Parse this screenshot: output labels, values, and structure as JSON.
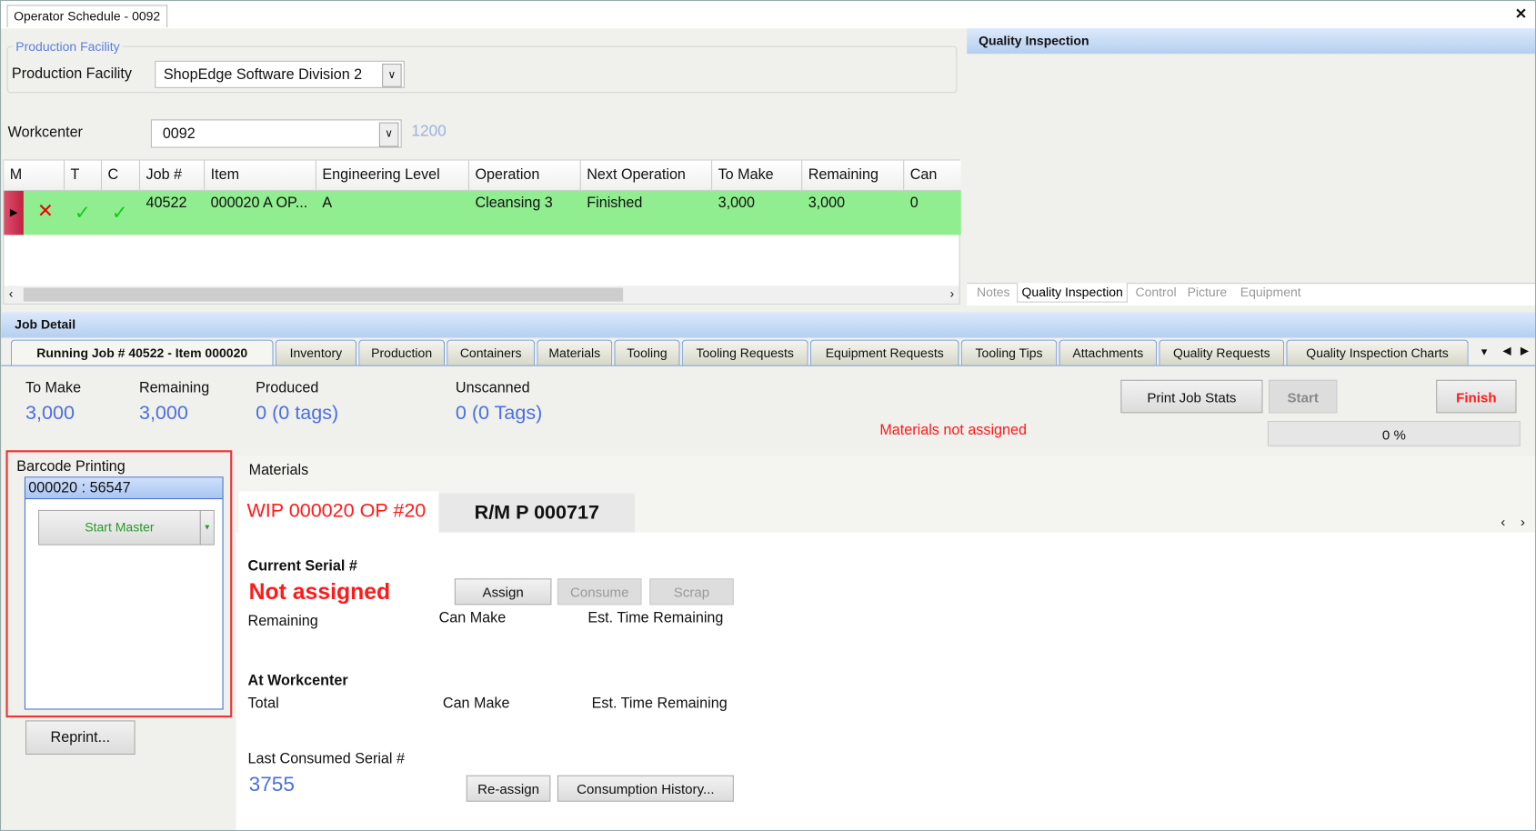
{
  "window": {
    "tab_title": "Operator Schedule - 0092",
    "close": "✕"
  },
  "facility": {
    "group_label": "Production Facility",
    "label": "Production Facility",
    "value": "ShopEdge Software Division 2"
  },
  "workcenter": {
    "label": "Workcenter",
    "value": "0092",
    "extra": "1200"
  },
  "grid": {
    "columns": [
      "M",
      "T",
      "C",
      "Job #",
      "Item",
      "Engineering Level",
      "Operation",
      "Next Operation",
      "To Make",
      "Remaining",
      "Can Ma"
    ],
    "row": {
      "m": "✕",
      "t": "✓",
      "c": "✓",
      "job": "40522",
      "item": "000020  A  OP...",
      "eng": "A",
      "operation": "Cleansing 3",
      "next": "Finished",
      "to_make": "3,000",
      "remaining": "3,000",
      "can_make": "0"
    },
    "row_color": "#90ee90"
  },
  "quality": {
    "title": "Quality Inspection",
    "tabs": [
      "Notes",
      "Quality Inspection",
      "Control",
      "Picture",
      "Equipment"
    ]
  },
  "job_detail": {
    "title": "Job Detail",
    "tabs": [
      "Running Job # 40522 - Item 000020",
      "Inventory",
      "Production",
      "Containers",
      "Materials",
      "Tooling",
      "Tooling Requests",
      "Equipment Requests",
      "Tooling Tips",
      "Attachments",
      "Quality Requests",
      "Quality Inspection Charts"
    ],
    "stats": {
      "to_make_label": "To Make",
      "to_make": "3,000",
      "remaining_label": "Remaining",
      "remaining": "3,000",
      "produced_label": "Produced",
      "produced": "0 (0 tags)",
      "unscanned_label": "Unscanned",
      "unscanned": "0 (0 Tags)"
    },
    "print_stats": "Print Job Stats",
    "start": "Start",
    "finish": "Finish",
    "progress": "0 %",
    "progress_value": 0,
    "warning": "Materials not assigned"
  },
  "barcode": {
    "title": "Barcode Printing",
    "item": "000020 : 56547",
    "start_master": "Start Master",
    "reprint": "Reprint..."
  },
  "materials": {
    "title": "Materials",
    "tabs": [
      "WIP 000020 OP #20",
      "R/M P 000717"
    ],
    "current_serial_label": "Current Serial #",
    "current_serial": "Not assigned",
    "assign": "Assign",
    "consume": "Consume",
    "scrap": "Scrap",
    "remaining_label": "Remaining",
    "can_make_label": "Can Make",
    "est_time_label": "Est. Time Remaining",
    "at_wc_label": "At Workcenter",
    "total_label": "Total",
    "wc_can_make_label": "Can Make",
    "wc_est_time_label": "Est. Time Remaining",
    "last_serial_label": "Last Consumed Serial #",
    "last_serial": "3755",
    "reassign": "Re-assign",
    "history": "Consumption History..."
  },
  "colors": {
    "accent": "#4a6fe0",
    "error": "#ff1a1a",
    "header": "#b5cff0"
  }
}
